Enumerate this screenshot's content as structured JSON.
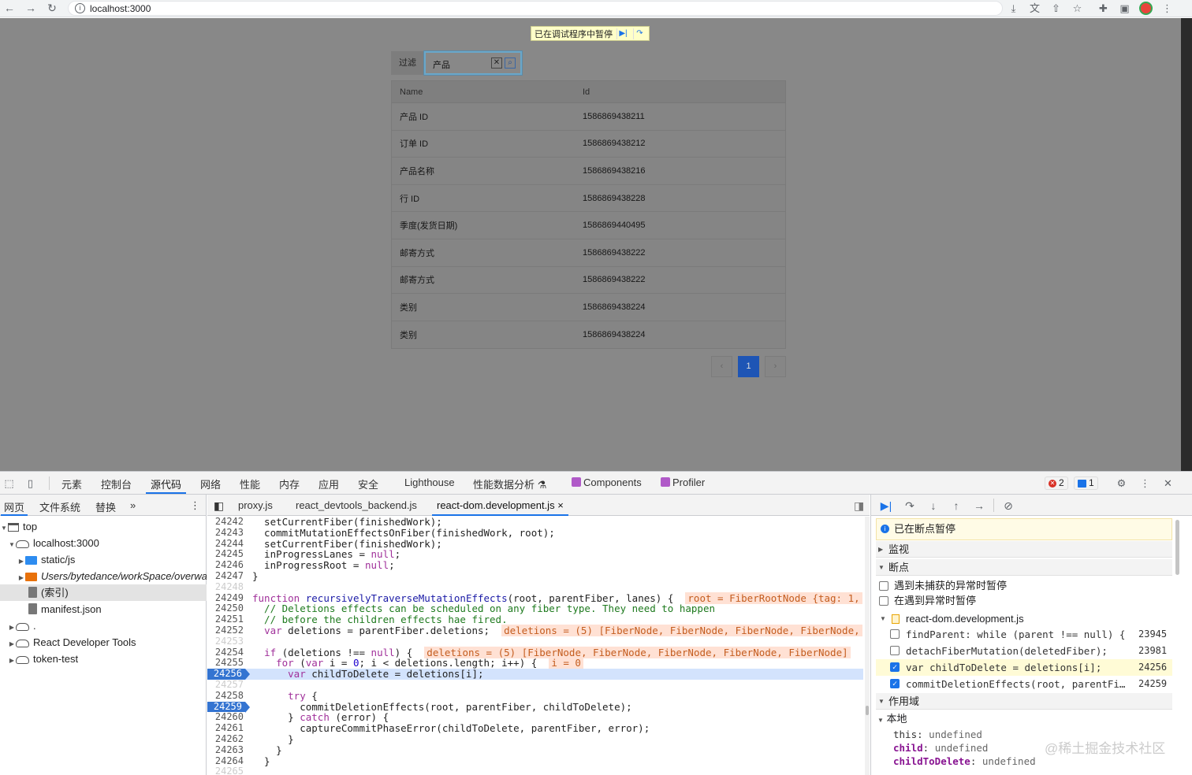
{
  "browser": {
    "url": "localhost:3000"
  },
  "page": {
    "paused_banner": "已在调试程序中暂停",
    "filter": {
      "label": "过滤",
      "value": "产品"
    },
    "table": {
      "headers": [
        "Name",
        "Id"
      ],
      "rows": [
        [
          "产品 ID",
          "1586869438211"
        ],
        [
          "订单 ID",
          "1586869438212"
        ],
        [
          "产品名称",
          "1586869438216"
        ],
        [
          "行 ID",
          "1586869438228"
        ],
        [
          "季度(发货日期)",
          "1586869440495"
        ],
        [
          "邮寄方式",
          "1586869438222"
        ],
        [
          "邮寄方式",
          "1586869438222"
        ],
        [
          "类别",
          "1586869438224"
        ],
        [
          "类别",
          "1586869438224"
        ]
      ]
    },
    "pagination": {
      "prev": "‹",
      "current": "1",
      "next": "›"
    }
  },
  "devtools": {
    "tabs": [
      "元素",
      "控制台",
      "源代码",
      "网络",
      "性能",
      "内存",
      "应用",
      "安全",
      "Lighthouse",
      "性能数据分析",
      "Components",
      "Profiler"
    ],
    "active_tab": "源代码",
    "error_count": "2",
    "message_count": "1",
    "navigator": {
      "tabs": [
        "网页",
        "文件系统",
        "替换"
      ],
      "more": "»",
      "tree": [
        {
          "label": "top"
        },
        {
          "label": "localhost:3000"
        },
        {
          "label": "static/js"
        },
        {
          "label": "Users/bytedance/workSpace/overwa"
        },
        {
          "label": "(索引)"
        },
        {
          "label": "manifest.json"
        },
        {
          "label": "."
        },
        {
          "label": "React Developer Tools"
        },
        {
          "label": "token-test"
        }
      ]
    },
    "editor": {
      "tabs": [
        "proxy.js",
        "react_devtools_backend.js",
        "react-dom.development.js"
      ],
      "active_tab": "react-dom.development.js",
      "close": "×",
      "line_numbers": [
        "24242",
        "24243",
        "24244",
        "24245",
        "24246",
        "24247",
        "24248",
        "24249",
        "24250",
        "24251",
        "24252",
        "24253",
        "24254",
        "24255",
        "24256",
        "24257",
        "24258",
        "24259",
        "24260",
        "24261",
        "24262",
        "24263",
        "24264",
        "24265"
      ],
      "lines": [
        "  setCurrentFiber(finishedWork);",
        "  commitMutationEffectsOnFiber(finishedWork, root);",
        "  setCurrentFiber(finishedWork);",
        "  inProgressLanes = null;",
        "  inProgressRoot = null;",
        "}",
        "",
        "function recursivelyTraverseMutationEffects(root, parentFiber, lanes) {",
        "  // Deletions effects can be scheduled on any fiber type. They need to happen",
        "  // before the children effects hae fired.",
        "  var deletions = parentFiber.deletions;",
        "",
        "  if (deletions !== null) {",
        "    for (var i = 0; i < deletions.length; i++) {",
        "      var childToDelete = deletions[i];",
        "",
        "      try {",
        "        commitDeletionEffects(root, parentFiber, childToDelete);",
        "      } catch (error) {",
        "        captureCommitPhaseError(childToDelete, parentFiber, error);",
        "      }",
        "    }",
        "  }",
        ""
      ],
      "inline_values": {
        "root": "root = FiberRootNode {tag: 1,",
        "deletions1": "deletions = (5) [FiberNode, FiberNode, FiberNode, FiberNode,",
        "deletions2": "deletions = (5) [FiberNode, FiberNode, FiberNode, FiberNode, FiberNode]",
        "i": "i = 0"
      }
    },
    "sidebar": {
      "paused_message": "已在断点暂停",
      "watch": "监视",
      "breakpoints": "断点",
      "pause_uncaught": "遇到未捕获的异常时暂停",
      "pause_caught": "在遇到异常时暂停",
      "bp_file": "react-dom.development.js",
      "bp_items": [
        {
          "code": "findParent: while (parent !== null) {",
          "line": "23945",
          "checked": false
        },
        {
          "code": "detachFiberMutation(deletedFiber);",
          "line": "23981",
          "checked": false
        },
        {
          "code": "var childToDelete = deletions[i];",
          "line": "24256",
          "checked": true
        },
        {
          "code": "commitDeletionEffects(root, parentFi…",
          "line": "24259",
          "checked": true
        }
      ],
      "scope": "作用域",
      "local": "本地",
      "locals": [
        {
          "key": "this",
          "value": "undefined"
        },
        {
          "key": "child",
          "value": "undefined"
        },
        {
          "key": "childToDelete",
          "value": "undefined"
        }
      ]
    }
  },
  "watermark": "@稀土掘金技术社区"
}
